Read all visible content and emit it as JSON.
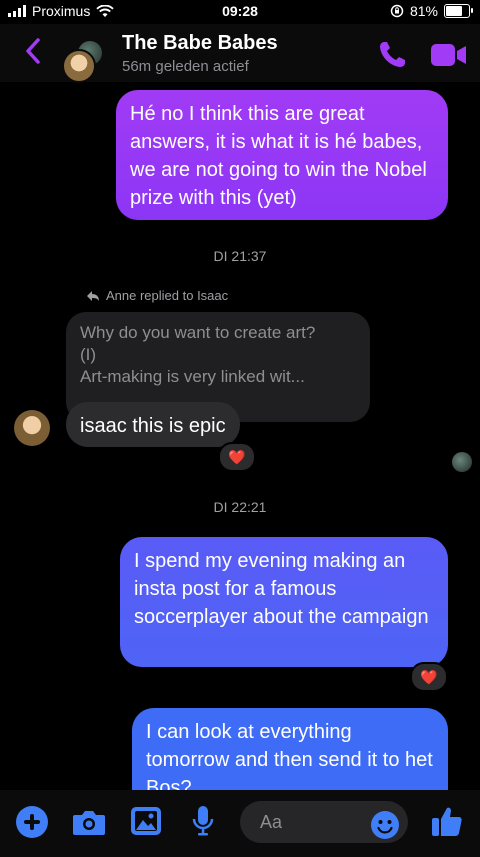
{
  "status_bar": {
    "carrier": "Proximus",
    "time": "09:28",
    "battery": "81%",
    "battery_level": 0.81
  },
  "header": {
    "title": "The Babe Babes",
    "subtitle": "56m geleden actief"
  },
  "messages": {
    "m1": "Hé no I think this are great answers, it is what it is hé babes, we are not going to win the Nobel prize with this (yet)",
    "stamp1": "DI 21:37",
    "reply_label": "Anne replied to Isaac",
    "quote_line1": "Why do you want to create art?",
    "quote_line2": "(I)",
    "quote_line3": "Art-making is very linked wit...",
    "m2": "isaac this is epic",
    "reaction": "❤️",
    "stamp2": "DI 22:21",
    "m3": "I spend my evening making an insta post for a famous soccerplayer about the campaign",
    "m4": "I can look at everything tomorrow and then send it to het Bos?"
  },
  "composer": {
    "placeholder": "Aa"
  },
  "colors": {
    "accent": "#a13bf5",
    "blue": "#3f7ef6"
  }
}
